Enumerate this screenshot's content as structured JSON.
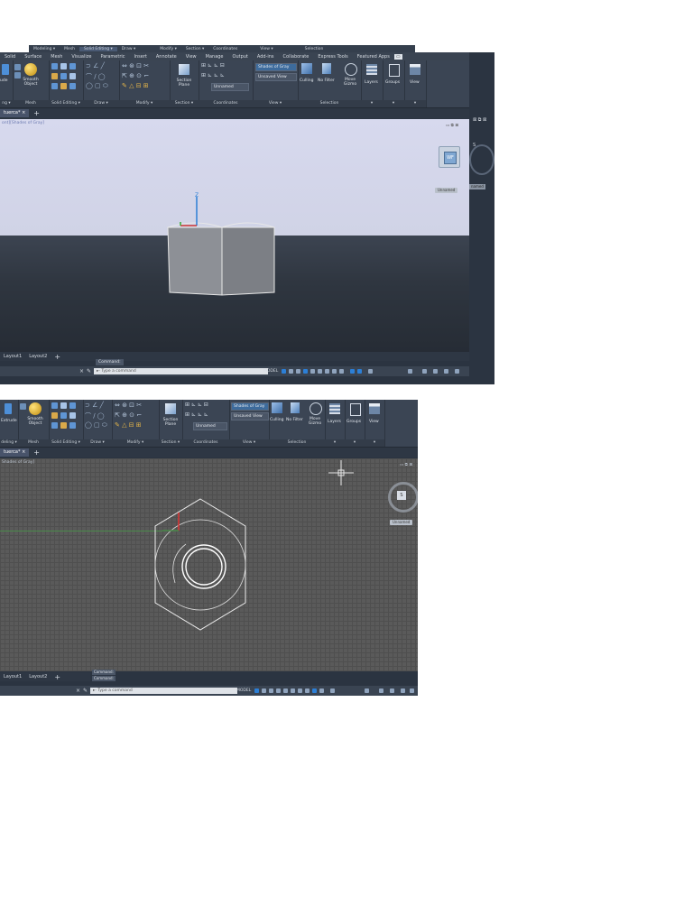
{
  "screenshot1": {
    "floating_toolbar": [
      "Modeling ▾",
      "Mesh",
      "Solid Editing ▾",
      "Draw ▾",
      "Modify ▾",
      "Section ▾",
      "Coordinates",
      "View ▾",
      "Selection"
    ],
    "menu_tabs": [
      "Solid",
      "Surface",
      "Mesh",
      "Visualize",
      "Parametric",
      "Insert",
      "Annotate",
      "View",
      "Manage",
      "Output",
      "Add-ins",
      "Collaborate",
      "Express Tools",
      "Featured Apps"
    ],
    "ribbon": {
      "extrude_partial": "ude",
      "smooth_object": "Smooth Object",
      "section_plane": "Section Plane",
      "culling": "Culling",
      "no_filter": "No Filter",
      "move_gizmo": "Move Gizmo",
      "layers": "Layers",
      "groups": "Groups",
      "view": "View",
      "visual_style": "Shades of Gray",
      "view_combo": "Unsaved View",
      "ucs_combo": "Unnamed",
      "panels": [
        "ng ▾",
        "Mesh",
        "Solid Editing ▾",
        "Draw ▾",
        "Modify ▾",
        "Section ▾",
        "Coordinates",
        "View ▾",
        "Selection"
      ]
    },
    "file_tab": "tuerca*",
    "viewport_label": "ont][Shades of Gray]",
    "viewcube_face": "S",
    "viewcube_arrow": "WF",
    "unnamed_label": "Unnamed",
    "layout_tabs": [
      "Layout1",
      "Layout2"
    ],
    "command_history": "Command:",
    "command_placeholder": "Type a command",
    "status_model": "MODEL",
    "side_label": "named"
  },
  "screenshot2": {
    "ribbon": {
      "extrude": "Extrude",
      "smooth_object": "Smooth Object",
      "section_plane": "Section Plane",
      "culling": "Culling",
      "no_filter": "No Filter",
      "move_gizmo": "Move Gizmo",
      "layers": "Layers",
      "groups": "Groups",
      "view": "View",
      "visual_style": "Shades of Gray",
      "view_combo": "Unsaved View",
      "ucs_combo": "Unnamed",
      "panels": [
        "deling ▾",
        "Mesh",
        "Solid Editing ▾",
        "Draw ▾",
        "Modify ▾",
        "Section ▾",
        "Coordinates",
        "View ▾",
        "Selection"
      ]
    },
    "file_tab": "tuerca*",
    "viewport_label": "Shades of Gray]",
    "viewcube_face": "S",
    "unnamed_label": "Unnamed",
    "layout_tabs": [
      "Layout1",
      "Layout2"
    ],
    "command_history": [
      "Command:",
      "Command:"
    ],
    "command_placeholder": "Type a command",
    "status_model": "MODEL"
  },
  "colors": {
    "ribbon_bg": "#3b4554",
    "viewport_sky": "#d6d8ec",
    "ground_dark": "#2a3039",
    "grid_bg": "#555555",
    "accent_blue": "#2c7fd6"
  }
}
